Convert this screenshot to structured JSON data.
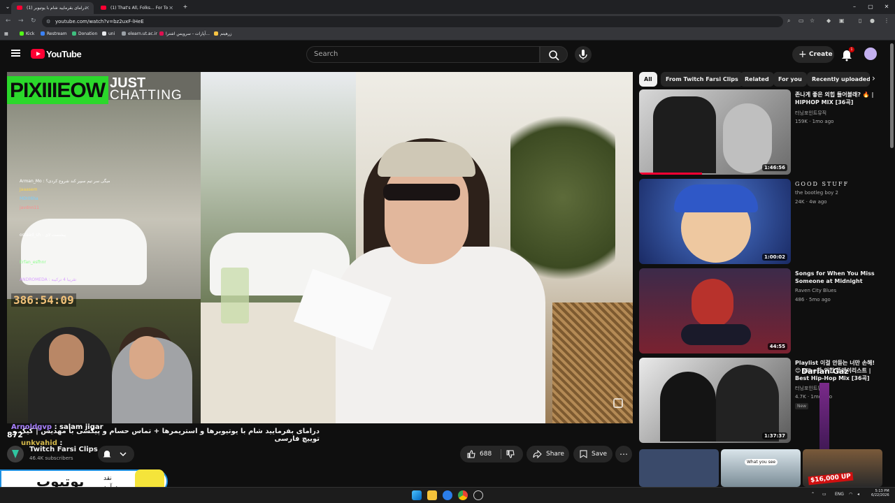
{
  "browser": {
    "tabs": [
      {
        "title": "(1) درامای بقرمایید شام با یوتیوبر",
        "active": true
      },
      {
        "title": "(1) That's All, Folks... For To",
        "active": false
      }
    ],
    "url": "youtube.com/watch?v=bz2uxF-lHeE",
    "bookmarks": [
      "Kick",
      "Restream",
      "Donation",
      "uni",
      "elearn.ut.ac.ir",
      "آپارات - سرویس اشترا...",
      "زرهیتم"
    ]
  },
  "youtube": {
    "search_placeholder": "Search",
    "create_label": "Create",
    "notification_count": "1"
  },
  "player": {
    "overlay_logo": "PIXIIIEOW",
    "overlay_just": "JUST",
    "overlay_chatting": "CHATTING",
    "stream_timer": "386:54:09",
    "chat_lines": [
      "Arman_Mo : میگی سر تیم سیپر کند شروع کردی؟",
      "Jaaasem",
      "MDI06ha",
      "javdnn11",
      "ostaad_sh : پیشست لای",
      "Erfan_esfhnr",
      "ANDROMEDA : تقریبا 4 ترکیبه"
    ]
  },
  "video": {
    "title": "درامای بفرمایید شام با یوتیوبرها و استریمرها + تماس حسام و پیکسی با مهدیس | کیک و توییچ فارسی",
    "overlay_user1": "Arnoldgvp",
    "overlay_msg1": ": salam jigar",
    "overlay_user2": "unkvahid",
    "overlay_msg2": ":",
    "overlay_number": "872",
    "channel_name": "Twitch Farsi Clips",
    "subscribers": "46.4K subscribers",
    "likes": "688",
    "share_label": "Share",
    "save_label": "Save"
  },
  "bottom_overlay": {
    "main": "یوتیوب",
    "sub1": "نقد",
    "sub2": "درآمد"
  },
  "sidebar": {
    "chips": [
      "All",
      "From Twitch Farsi Clips",
      "Related",
      "For you",
      "Recently uploaded"
    ],
    "videos": [
      {
        "title": "존나게 좋은 외힙 들어볼래? 🔥 | HIPHOP MIX [36곡]",
        "channel": "터닝포인트뮤직",
        "meta": "159K · 1mo ago",
        "duration": "1:46:56"
      },
      {
        "title": "GOOD STUFF",
        "channel": "the bootleg boy 2",
        "meta": "24K · 4w ago",
        "duration": "1:00:02"
      },
      {
        "title": "Songs for When You Miss Someone at Midnight",
        "channel": "Raven City Blues",
        "meta": "486 · 5mo ago",
        "duration": "44:55"
      },
      {
        "title": "Playlist 이걸 안듣는 너만 손해! 😊 Vibe한 외힙 플레이리스트 | Best Hip-Hop Mix [36곡]",
        "channel": "터닝포인트뮤직",
        "meta": "4.7K · 1mo ago",
        "duration": "1:37:37",
        "badge": "New"
      }
    ],
    "bottom_thumb_caption": "What you see",
    "bottom_thumb_price": "$16,000 UP"
  },
  "overlay_alert": "Darian Gaz",
  "taskbar": {
    "lang": "ENG",
    "time": "5:13 PM",
    "date": "6/22/2026"
  }
}
